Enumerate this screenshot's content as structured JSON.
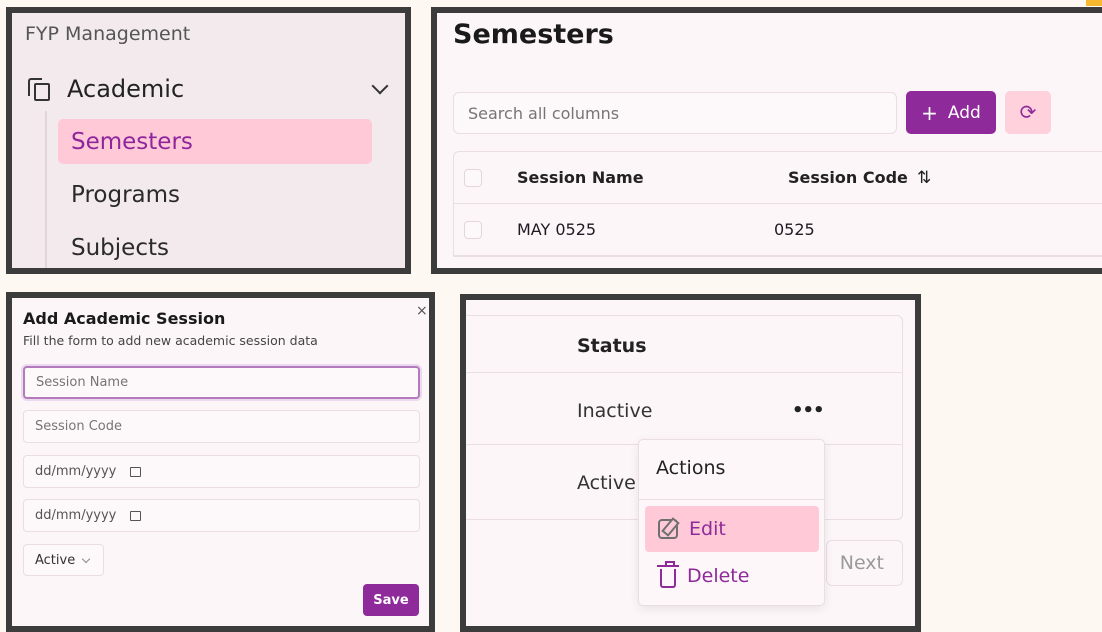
{
  "sidebar": {
    "brand": "FYP Management",
    "group_label": "Academic",
    "items": [
      {
        "label": "Semesters",
        "active": true
      },
      {
        "label": "Programs",
        "active": false
      },
      {
        "label": "Subjects",
        "active": false
      }
    ]
  },
  "semesters": {
    "title": "Semesters",
    "search_placeholder": "Search all columns",
    "add_label": "Add",
    "columns": [
      "Session Name",
      "Session Code"
    ],
    "rows": [
      {
        "session_name": "MAY 0525",
        "session_code": "0525"
      }
    ]
  },
  "form": {
    "title": "Add Academic Session",
    "subtitle": "Fill the form to add new academic session data",
    "close_glyph": "×",
    "session_name_placeholder": "Session Name",
    "session_code_placeholder": "Session Code",
    "start_date_placeholder": "dd/mm/yyyy",
    "end_date_placeholder": "dd/mm/yyyy",
    "status_value": "Active",
    "save_label": "Save"
  },
  "status_panel": {
    "column_header": "Status",
    "rows": [
      "Inactive",
      "Active"
    ],
    "row_menu_glyph": "•••",
    "next_label": "Next",
    "menu": {
      "title": "Actions",
      "edit_label": "Edit",
      "delete_label": "Delete"
    }
  },
  "colors": {
    "primary": "#8e2a9a",
    "active_bg": "#ffc9d8",
    "border": "#3c3c3c"
  }
}
